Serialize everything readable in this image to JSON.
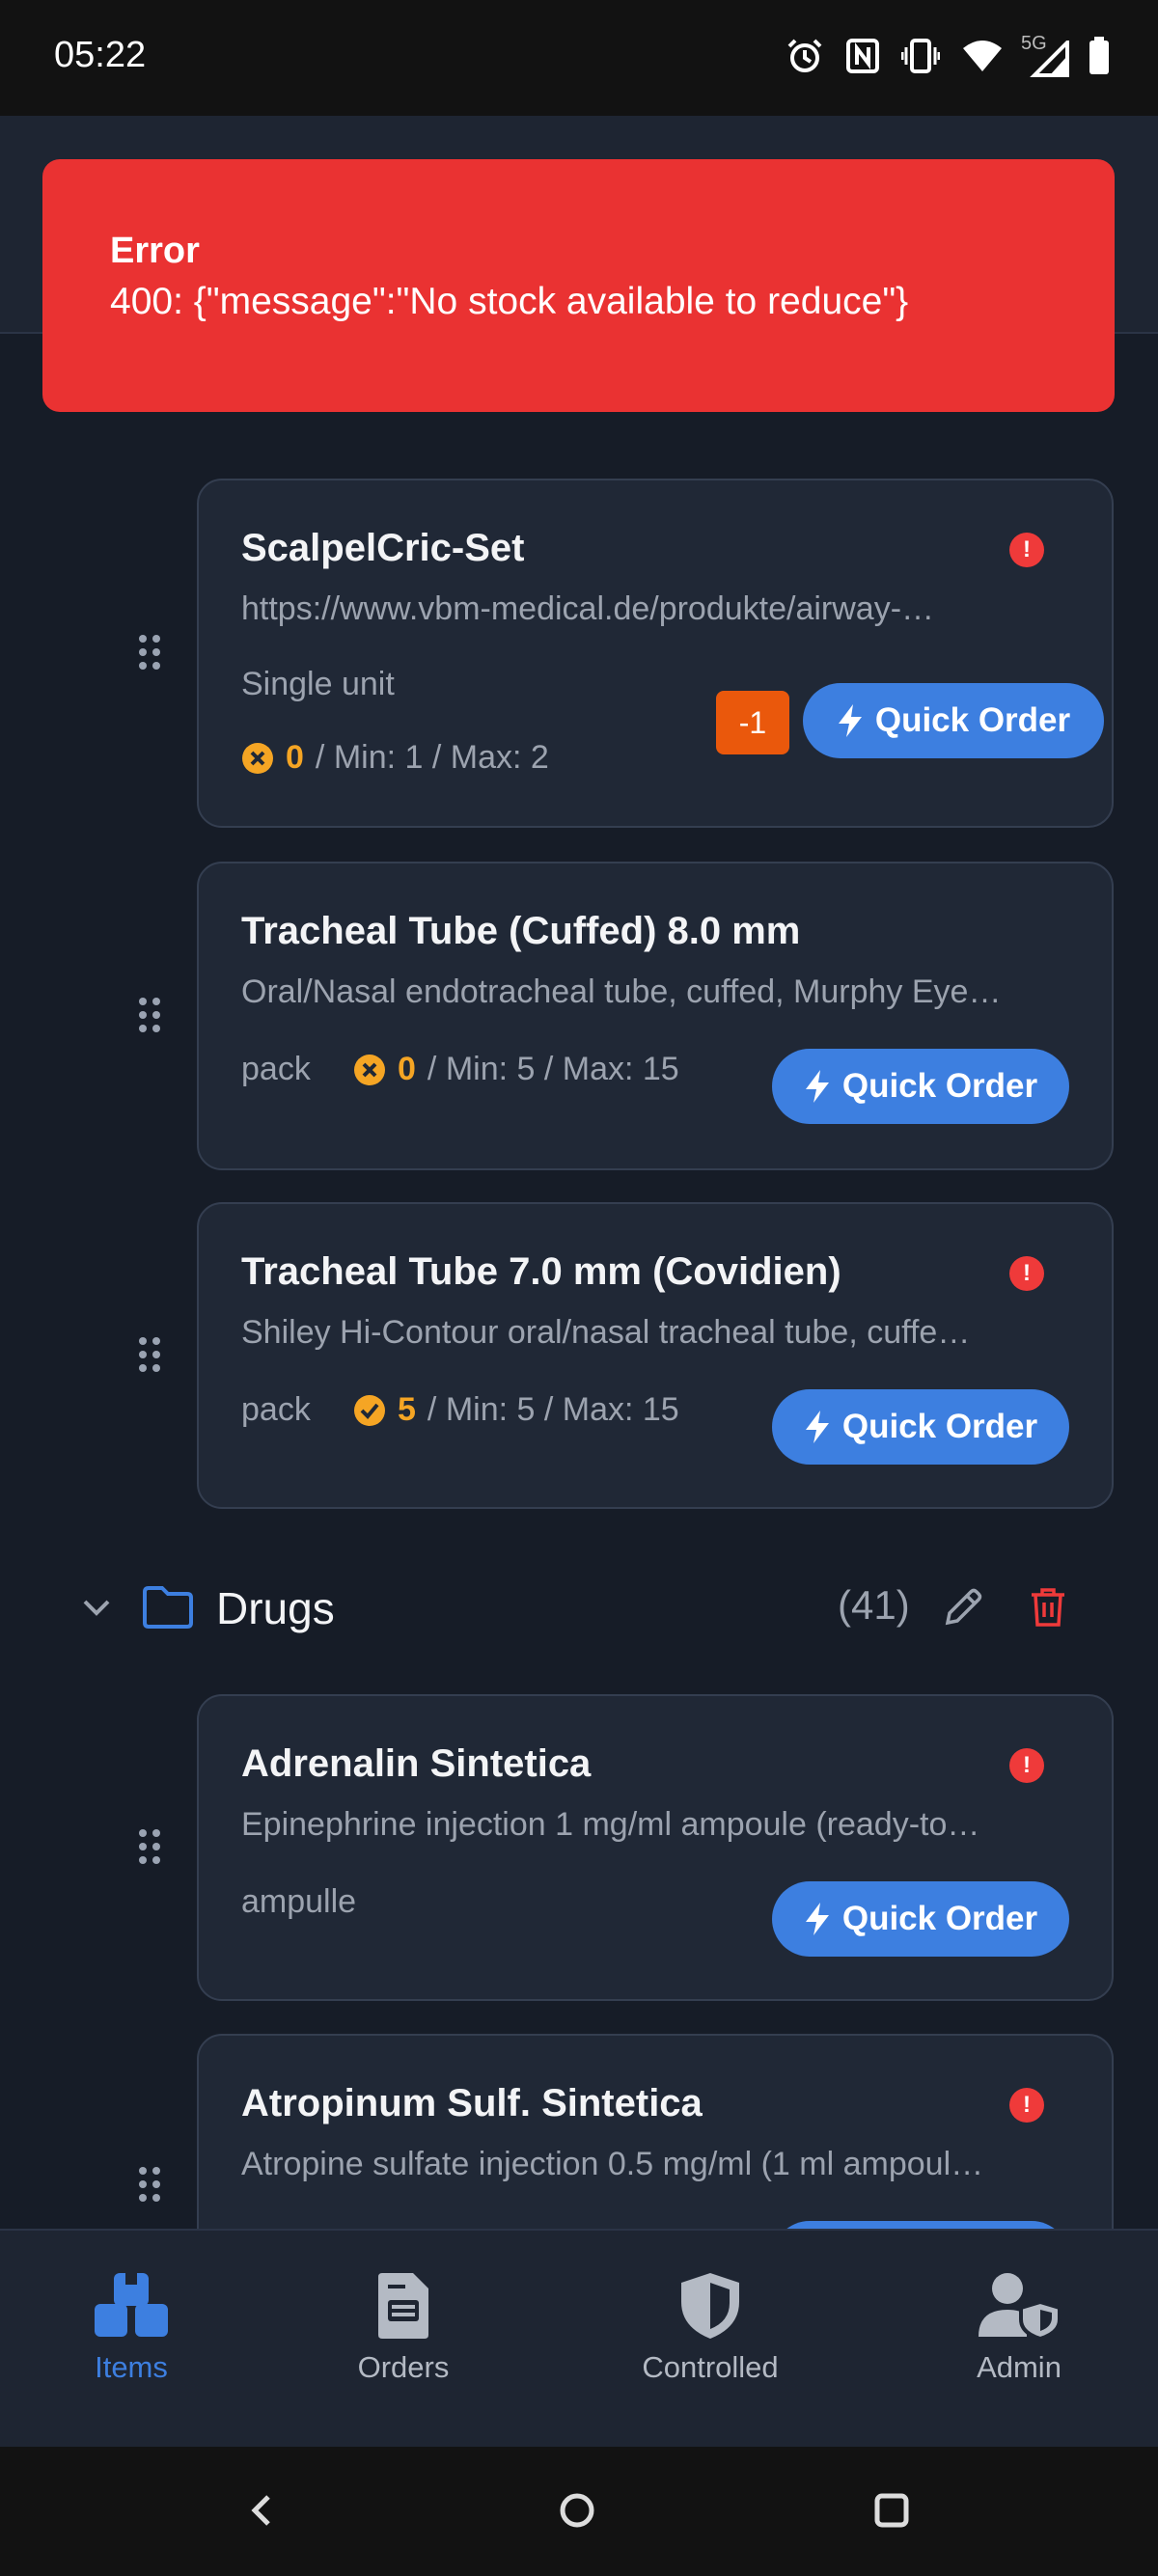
{
  "status_bar": {
    "time": "05:22",
    "network": "5G"
  },
  "toast": {
    "title": "Error",
    "message": "400: {\"message\":\"No stock available to reduce\"}"
  },
  "items_top": [
    {
      "title": "ScalpelCric-Set",
      "description": "https://www.vbm-medical.de/produkte/airway-…",
      "unit": "Single unit",
      "stock": "0",
      "minmax": "/ Min: 1 / Max: 2",
      "minus_label": "-1",
      "quick_order_label": "Quick Order"
    },
    {
      "title": "Tracheal Tube (Cuffed) 8.0 mm",
      "description": "Oral/Nasal endotracheal tube, cuffed, Murphy Eye…",
      "unit": "pack",
      "stock": "0",
      "minmax": "/ Min: 5 / Max: 15",
      "quick_order_label": "Quick Order"
    },
    {
      "title": "Tracheal Tube 7.0 mm (Covidien)",
      "description": "Shiley Hi-Contour oral/nasal tracheal tube, cuffe…",
      "unit": "pack",
      "stock": "5",
      "minmax": "/ Min: 5 / Max: 15",
      "quick_order_label": "Quick Order"
    }
  ],
  "section": {
    "title": "Drugs",
    "count": "(41)"
  },
  "items_drugs": [
    {
      "title": "Adrenalin Sintetica",
      "description": "Epinephrine injection 1 mg/ml ampoule (ready-to…",
      "unit": "ampulle",
      "quick_order_label": "Quick Order"
    },
    {
      "title": "Atropinum Sulf. Sintetica",
      "description": "Atropine sulfate injection 0.5 mg/ml (1 ml ampoul…"
    }
  ],
  "bottom_nav": [
    {
      "label": "Items",
      "icon": "boxes-icon",
      "active": true
    },
    {
      "label": "Orders",
      "icon": "document-icon",
      "active": false
    },
    {
      "label": "Controlled",
      "icon": "shield-icon",
      "active": false
    },
    {
      "label": "Admin",
      "icon": "user-shield-icon",
      "active": false
    }
  ],
  "colors": {
    "accent": "#3d7fe0",
    "warning": "#f5a524",
    "error": "#ea3232",
    "minus": "#ea580c"
  }
}
